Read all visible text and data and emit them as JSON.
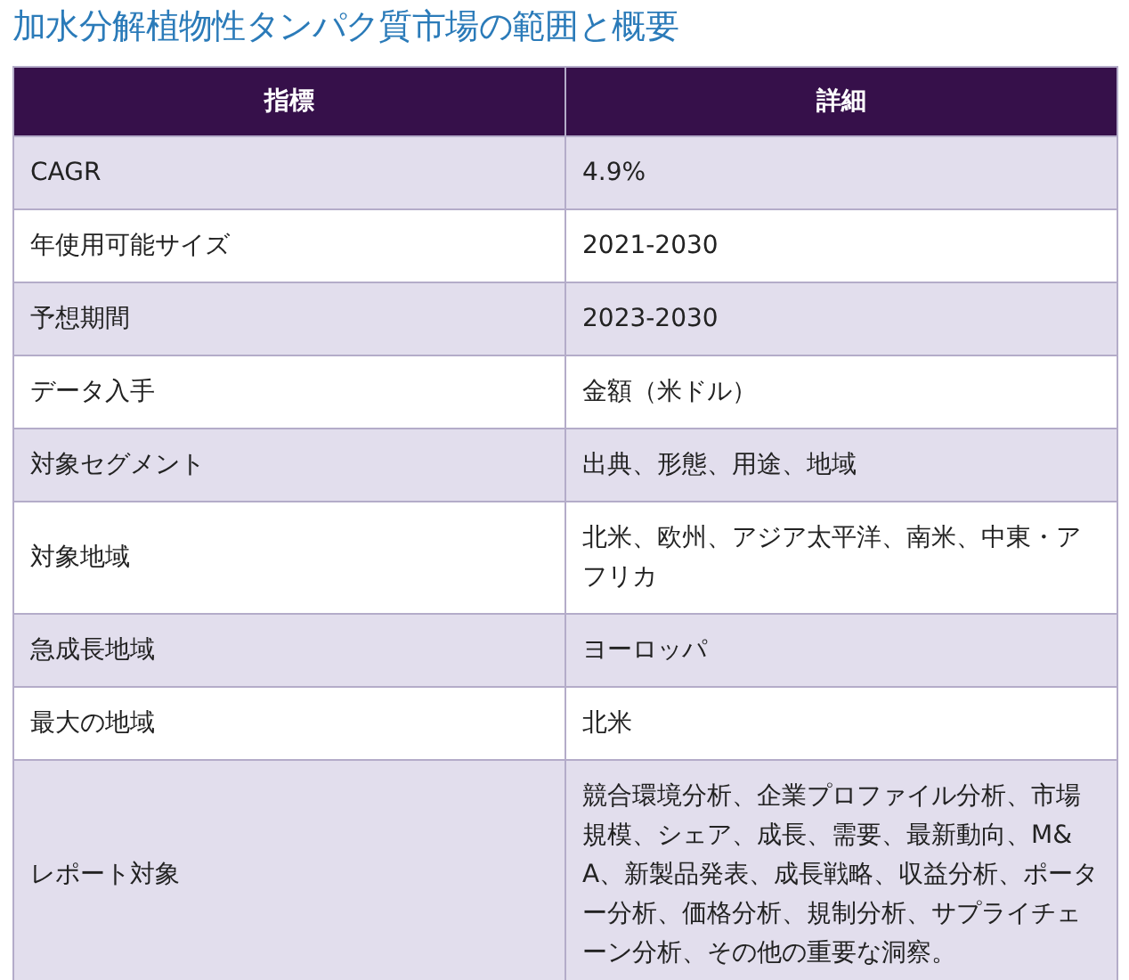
{
  "title": "加水分解植物性タンパク質市場の範囲と概要",
  "table": {
    "columns": [
      "指標",
      "詳細"
    ],
    "rows": [
      {
        "metric": "CAGR",
        "detail": "4.9%"
      },
      {
        "metric": "年使用可能サイズ",
        "detail": "2021-2030"
      },
      {
        "metric": "予想期間",
        "detail": "2023-2030"
      },
      {
        "metric": "データ入手",
        "detail": "金額（米ドル）"
      },
      {
        "metric": "対象セグメント",
        "detail": "出典、形態、用途、地域"
      },
      {
        "metric": "対象地域",
        "detail": "北米、欧州、アジア太平洋、南米、中東・アフリカ"
      },
      {
        "metric": "急成長地域",
        "detail": "ヨーロッパ"
      },
      {
        "metric": "最大の地域",
        "detail": "北米"
      },
      {
        "metric": "レポート対象",
        "detail": "競合環境分析、企業プロファイル分析、市場規模、シェア、成長、需要、最新動向、M&A、新製品発表、成長戦略、収益分析、ポーター分析、価格分析、規制分析、サプライチェーン分析、その他の重要な洞察。"
      }
    ]
  }
}
